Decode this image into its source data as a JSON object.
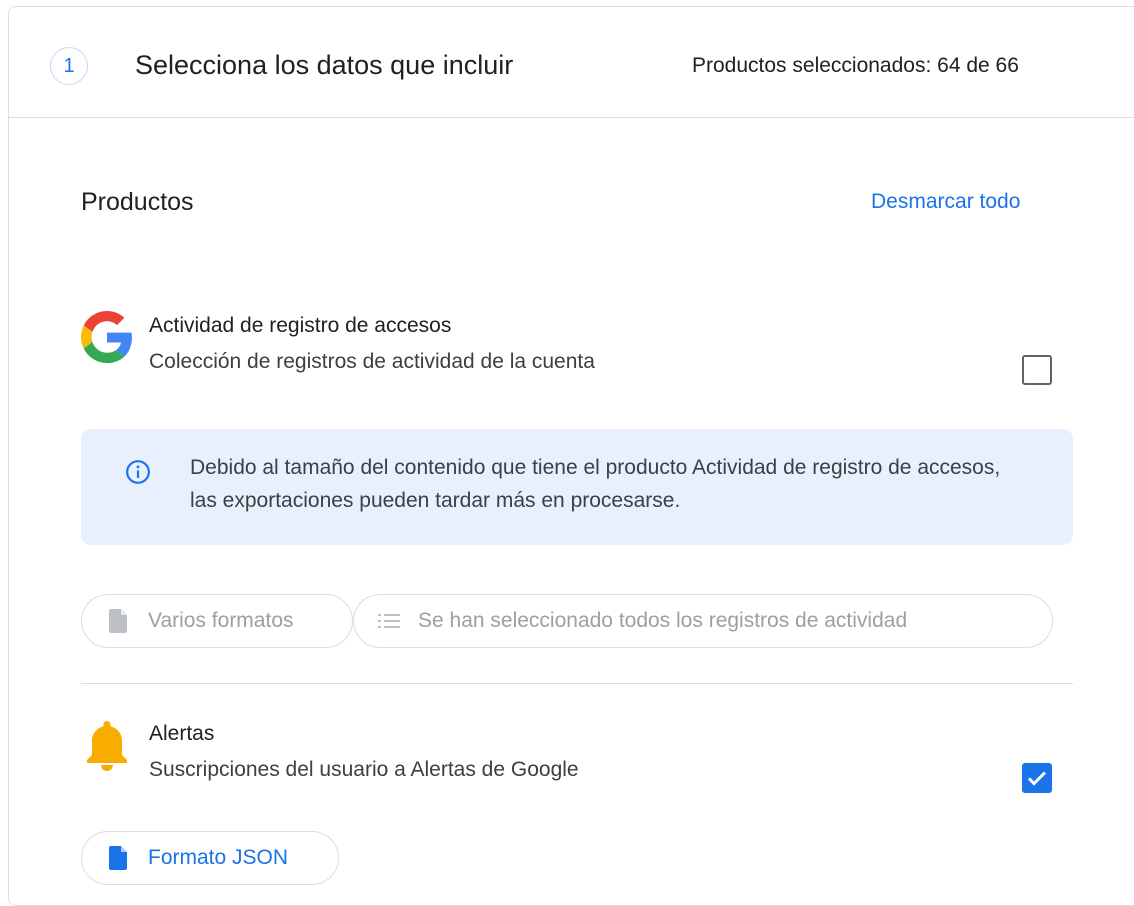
{
  "step": {
    "number": "1",
    "title": "Selecciona los datos que incluir",
    "selected_count": "Productos seleccionados: 64 de 66"
  },
  "products_section": {
    "heading": "Productos",
    "deselect_all_label": "Desmarcar todo"
  },
  "products": [
    {
      "name": "Actividad de registro de accesos",
      "description": "Colección de registros de actividad de la cuenta",
      "checked": false,
      "icon": "google-logo-icon",
      "info_message": "Debido al tamaño del contenido que tiene el producto Actividad de registro de accesos, las exportaciones pueden tardar más en procesarse.",
      "chips": [
        {
          "label": "Varios formatos",
          "icon": "file-icon",
          "enabled": false
        },
        {
          "label": "Se han seleccionado todos los registros de actividad",
          "icon": "list-icon",
          "enabled": false
        }
      ]
    },
    {
      "name": "Alertas",
      "description": "Suscripciones del usuario a Alertas de Google",
      "checked": true,
      "icon": "bell-icon",
      "chips": [
        {
          "label": "Formato JSON",
          "icon": "file-icon",
          "enabled": true
        }
      ]
    }
  ],
  "colors": {
    "accent": "#1a73e8",
    "info_background": "#e8f0fe",
    "border": "#dadce0",
    "disabled_text": "#9aa0a6",
    "bell": "#f9ab00"
  }
}
